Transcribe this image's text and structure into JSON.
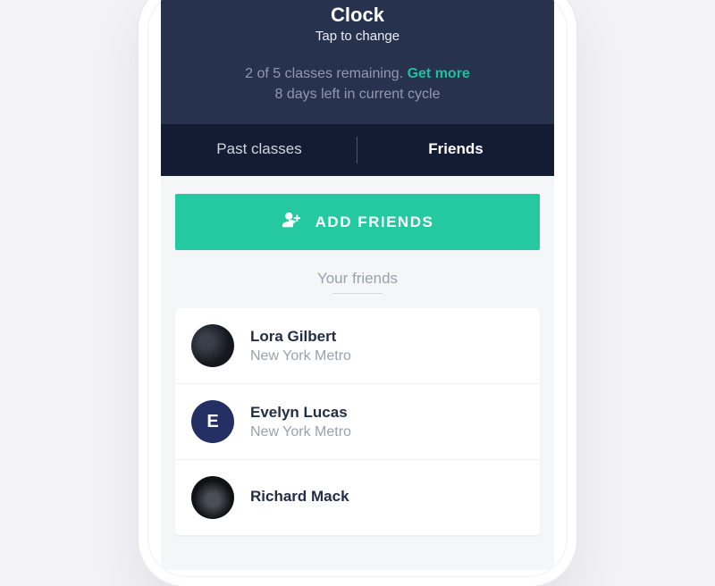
{
  "header": {
    "title": "Clock",
    "subtitle": "Tap to change",
    "status_prefix": "2 of 5 classes remaining. ",
    "status_link": "Get more",
    "status_line2": "8 days left in current cycle"
  },
  "tabs": {
    "past": "Past classes",
    "friends": "Friends",
    "active": "friends"
  },
  "actions": {
    "add_friends": "ADD FRIENDS"
  },
  "section": {
    "your_friends": "Your friends"
  },
  "friends": [
    {
      "name": "Lora Gilbert",
      "location": "New York Metro",
      "avatar": "photo1",
      "initial": ""
    },
    {
      "name": "Evelyn Lucas",
      "location": "New York Metro",
      "avatar": "initial",
      "initial": "E"
    },
    {
      "name": "Richard Mack",
      "location": "",
      "avatar": "photo2",
      "initial": ""
    }
  ]
}
